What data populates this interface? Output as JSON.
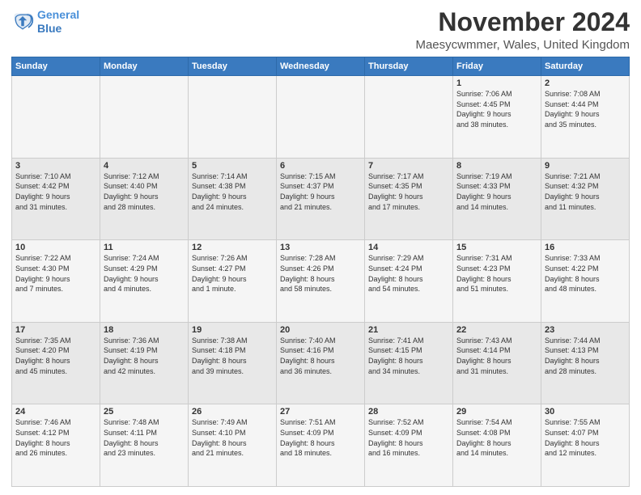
{
  "logo": {
    "line1": "General",
    "line2": "Blue"
  },
  "header": {
    "month_title": "November 2024",
    "location": "Maesycwmmer, Wales, United Kingdom"
  },
  "days_of_week": [
    "Sunday",
    "Monday",
    "Tuesday",
    "Wednesday",
    "Thursday",
    "Friday",
    "Saturday"
  ],
  "weeks": [
    [
      {
        "day": "",
        "info": ""
      },
      {
        "day": "",
        "info": ""
      },
      {
        "day": "",
        "info": ""
      },
      {
        "day": "",
        "info": ""
      },
      {
        "day": "",
        "info": ""
      },
      {
        "day": "1",
        "info": "Sunrise: 7:06 AM\nSunset: 4:45 PM\nDaylight: 9 hours\nand 38 minutes."
      },
      {
        "day": "2",
        "info": "Sunrise: 7:08 AM\nSunset: 4:44 PM\nDaylight: 9 hours\nand 35 minutes."
      }
    ],
    [
      {
        "day": "3",
        "info": "Sunrise: 7:10 AM\nSunset: 4:42 PM\nDaylight: 9 hours\nand 31 minutes."
      },
      {
        "day": "4",
        "info": "Sunrise: 7:12 AM\nSunset: 4:40 PM\nDaylight: 9 hours\nand 28 minutes."
      },
      {
        "day": "5",
        "info": "Sunrise: 7:14 AM\nSunset: 4:38 PM\nDaylight: 9 hours\nand 24 minutes."
      },
      {
        "day": "6",
        "info": "Sunrise: 7:15 AM\nSunset: 4:37 PM\nDaylight: 9 hours\nand 21 minutes."
      },
      {
        "day": "7",
        "info": "Sunrise: 7:17 AM\nSunset: 4:35 PM\nDaylight: 9 hours\nand 17 minutes."
      },
      {
        "day": "8",
        "info": "Sunrise: 7:19 AM\nSunset: 4:33 PM\nDaylight: 9 hours\nand 14 minutes."
      },
      {
        "day": "9",
        "info": "Sunrise: 7:21 AM\nSunset: 4:32 PM\nDaylight: 9 hours\nand 11 minutes."
      }
    ],
    [
      {
        "day": "10",
        "info": "Sunrise: 7:22 AM\nSunset: 4:30 PM\nDaylight: 9 hours\nand 7 minutes."
      },
      {
        "day": "11",
        "info": "Sunrise: 7:24 AM\nSunset: 4:29 PM\nDaylight: 9 hours\nand 4 minutes."
      },
      {
        "day": "12",
        "info": "Sunrise: 7:26 AM\nSunset: 4:27 PM\nDaylight: 9 hours\nand 1 minute."
      },
      {
        "day": "13",
        "info": "Sunrise: 7:28 AM\nSunset: 4:26 PM\nDaylight: 8 hours\nand 58 minutes."
      },
      {
        "day": "14",
        "info": "Sunrise: 7:29 AM\nSunset: 4:24 PM\nDaylight: 8 hours\nand 54 minutes."
      },
      {
        "day": "15",
        "info": "Sunrise: 7:31 AM\nSunset: 4:23 PM\nDaylight: 8 hours\nand 51 minutes."
      },
      {
        "day": "16",
        "info": "Sunrise: 7:33 AM\nSunset: 4:22 PM\nDaylight: 8 hours\nand 48 minutes."
      }
    ],
    [
      {
        "day": "17",
        "info": "Sunrise: 7:35 AM\nSunset: 4:20 PM\nDaylight: 8 hours\nand 45 minutes."
      },
      {
        "day": "18",
        "info": "Sunrise: 7:36 AM\nSunset: 4:19 PM\nDaylight: 8 hours\nand 42 minutes."
      },
      {
        "day": "19",
        "info": "Sunrise: 7:38 AM\nSunset: 4:18 PM\nDaylight: 8 hours\nand 39 minutes."
      },
      {
        "day": "20",
        "info": "Sunrise: 7:40 AM\nSunset: 4:16 PM\nDaylight: 8 hours\nand 36 minutes."
      },
      {
        "day": "21",
        "info": "Sunrise: 7:41 AM\nSunset: 4:15 PM\nDaylight: 8 hours\nand 34 minutes."
      },
      {
        "day": "22",
        "info": "Sunrise: 7:43 AM\nSunset: 4:14 PM\nDaylight: 8 hours\nand 31 minutes."
      },
      {
        "day": "23",
        "info": "Sunrise: 7:44 AM\nSunset: 4:13 PM\nDaylight: 8 hours\nand 28 minutes."
      }
    ],
    [
      {
        "day": "24",
        "info": "Sunrise: 7:46 AM\nSunset: 4:12 PM\nDaylight: 8 hours\nand 26 minutes."
      },
      {
        "day": "25",
        "info": "Sunrise: 7:48 AM\nSunset: 4:11 PM\nDaylight: 8 hours\nand 23 minutes."
      },
      {
        "day": "26",
        "info": "Sunrise: 7:49 AM\nSunset: 4:10 PM\nDaylight: 8 hours\nand 21 minutes."
      },
      {
        "day": "27",
        "info": "Sunrise: 7:51 AM\nSunset: 4:09 PM\nDaylight: 8 hours\nand 18 minutes."
      },
      {
        "day": "28",
        "info": "Sunrise: 7:52 AM\nSunset: 4:09 PM\nDaylight: 8 hours\nand 16 minutes."
      },
      {
        "day": "29",
        "info": "Sunrise: 7:54 AM\nSunset: 4:08 PM\nDaylight: 8 hours\nand 14 minutes."
      },
      {
        "day": "30",
        "info": "Sunrise: 7:55 AM\nSunset: 4:07 PM\nDaylight: 8 hours\nand 12 minutes."
      }
    ]
  ]
}
